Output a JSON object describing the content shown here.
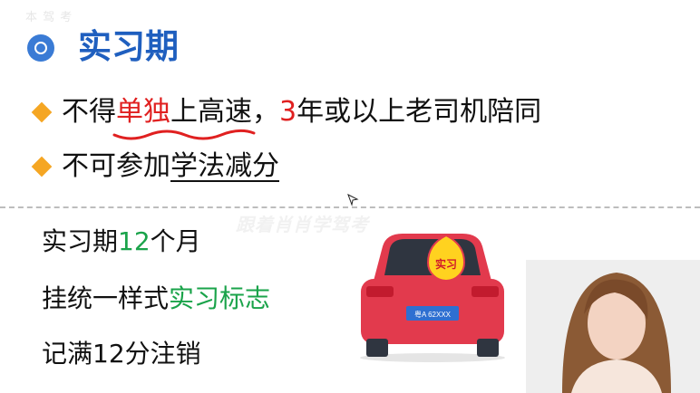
{
  "watermark_top": "本 驾 考",
  "title": "实习期",
  "bullet1": {
    "part1": "不得",
    "red1": "单独",
    "part2": "上高速，",
    "red2": "3",
    "part3": "年或以上老司机陪同"
  },
  "bullet2": {
    "part1": "不可参加",
    "underlined": "学法减分"
  },
  "info1": {
    "text": "实习期",
    "number": "12",
    "unit": "个月"
  },
  "info2": {
    "text": "挂统一样式",
    "highlight": "实习标志"
  },
  "info3": {
    "text": "记满12分注销"
  },
  "watermark": "跟着肖肖学驾考",
  "car": {
    "sign_text": "实习",
    "plate_text": "粤A 62XXX",
    "body_color": "#e23a4d",
    "sign_color": "#ffd21f"
  },
  "colors": {
    "title": "#1f5fbf",
    "red_text": "#e02020",
    "green_text": "#1aa34a",
    "diamond": "#f5a623"
  }
}
